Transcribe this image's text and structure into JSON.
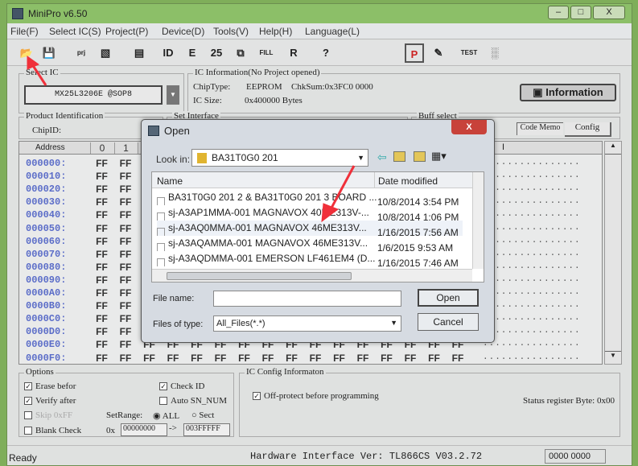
{
  "window": {
    "title": "MiniPro v6.50",
    "controls": [
      "–",
      "□",
      "X"
    ]
  },
  "menu": [
    "File(F)",
    "Select IC(S)",
    "Project(P)",
    "Device(D)",
    "Tools(V)",
    "Help(H)",
    "Language(L)"
  ],
  "toolbar": [
    {
      "icon": "open-folder-icon",
      "glyph": "📂"
    },
    {
      "icon": "save-icon",
      "glyph": "💾"
    },
    {
      "icon": "open-project-icon",
      "glyph": "prj"
    },
    {
      "icon": "save-project-icon",
      "glyph": "▧"
    },
    {
      "icon": "chip-icon",
      "glyph": "▤"
    },
    {
      "icon": "read-id-icon",
      "glyph": "ID"
    },
    {
      "icon": "erase-icon",
      "glyph": "E"
    },
    {
      "icon": "blank-check-icon",
      "glyph": "25"
    },
    {
      "icon": "copy-icon",
      "glyph": "⧉"
    },
    {
      "icon": "fill-icon",
      "glyph": "FILL"
    },
    {
      "icon": "read-icon",
      "glyph": "R"
    },
    {
      "icon": "help-icon",
      "glyph": "?"
    },
    {
      "icon": "program-icon",
      "glyph": "P"
    },
    {
      "icon": "edit-icon",
      "glyph": "✎"
    },
    {
      "icon": "test-icon",
      "glyph": "TEST"
    },
    {
      "icon": "ic-socket-icon",
      "glyph": "░"
    }
  ],
  "select_ic": {
    "label": "Select IC",
    "value": "MX25L3206E @SOP8"
  },
  "ic_info": {
    "label": "IC Information(No Project opened)",
    "chip_type_label": "ChipType:",
    "chip_type": "EEPROM",
    "chksum": "ChkSum:0x3FC0 0000",
    "ic_size_label": "IC Size:",
    "ic_size": "0x400000 Bytes",
    "info_button": "Information"
  },
  "product_id": {
    "label": "Product Identification",
    "chipid_label": "ChipID:"
  },
  "set_interface": {
    "label": "Set Interface"
  },
  "buff_select": {
    "label": "Buff select",
    "code_memo": "Code Memo",
    "config": "Config"
  },
  "grid": {
    "headers": [
      "Address",
      "0",
      "1"
    ],
    "ascii_header": "I",
    "rows": [
      "000000:",
      "000010:",
      "000020:",
      "000030:",
      "000040:",
      "000050:",
      "000060:",
      "000070:",
      "000080:",
      "000090:",
      "0000A0:",
      "0000B0:",
      "0000C0:",
      "0000D0:",
      "0000E0:",
      "0000F0:"
    ],
    "cell": "FF",
    "ascii": "................"
  },
  "options": {
    "label": "Options",
    "erase": "Erase befor",
    "verify": "Verify after",
    "check_id": "Check ID",
    "auto_sn": "Auto SN_NUM",
    "skip": "Skip 0xFF",
    "setrange": "SetRange:",
    "all": "ALL",
    "sect": "Sect",
    "blank": "Blank Check",
    "ox": "0x",
    "from": "00000000",
    "arrow": "->",
    "to": "003FFFFF",
    "erase_checked": true,
    "verify_checked": true,
    "check_id_checked": true,
    "auto_sn_checked": false,
    "skip_checked": false,
    "blank_checked": false,
    "range": "ALL"
  },
  "ic_config": {
    "label": "IC Config Informaton",
    "offprotect": "Off-protect before programming",
    "offprotect_checked": true,
    "status": "Status register Byte: 0x00"
  },
  "statusbar": {
    "left": "Ready",
    "center": "Hardware Interface Ver: TL866CS V03.2.72",
    "right": "0000 0000"
  },
  "dialog": {
    "title": "Open",
    "close": "X",
    "look_in_label": "Look in:",
    "look_in": "BA31T0G0 201",
    "col_name": "Name",
    "col_date": "Date modified",
    "files": [
      {
        "name": "BA31T0G0 201 2 & BA31T0G0 201 3 BOARD ...",
        "date": "10/8/2014 3:54 PM"
      },
      {
        "name": "sj-A3AP1MMA-001 MAGNAVOX 40ME313V-...",
        "date": "10/8/2014 1:06 PM"
      },
      {
        "name": "sj-A3AQ0MMA-001 MAGNAVOX 46ME313V...",
        "date": "1/16/2015 7:56 AM"
      },
      {
        "name": "sj-A3AQAMMA-001 MAGNAVOX 46ME313V...",
        "date": "1/6/2015 9:53 AM"
      },
      {
        "name": "sj-A3AQDMMA-001 EMERSON LF461EM4 (D...",
        "date": "1/16/2015 7:46 AM"
      }
    ],
    "file_name_label": "File name:",
    "file_name": "",
    "type_label": "Files of type:",
    "type": "All_Files(*.*)",
    "open": "Open",
    "cancel": "Cancel"
  },
  "colors": {
    "accent_arrow": "#f0303a",
    "address": "#5a6cc8",
    "frame": "#8cbf68"
  }
}
